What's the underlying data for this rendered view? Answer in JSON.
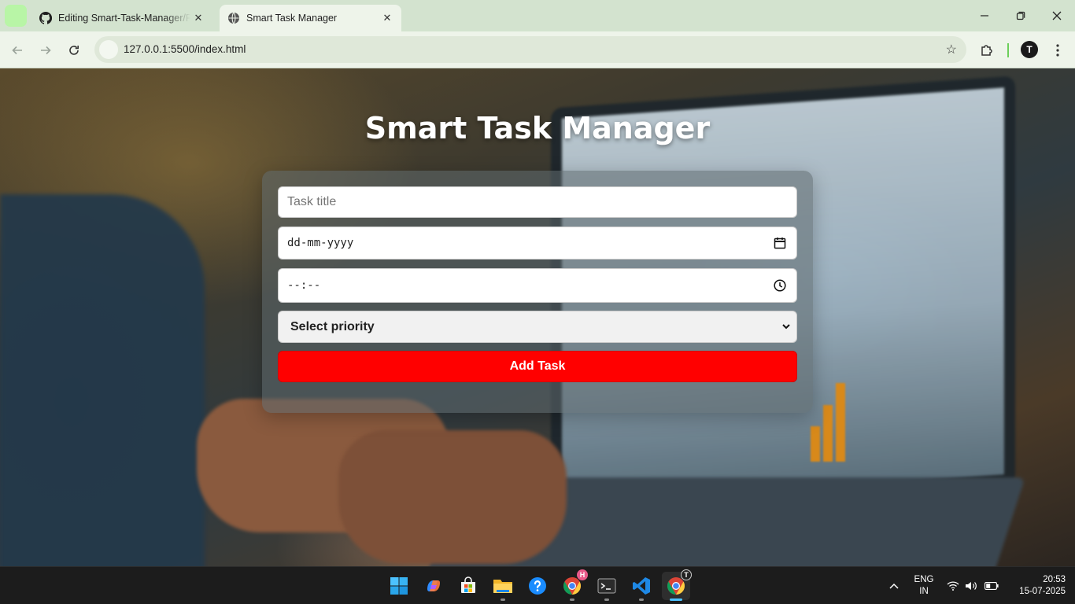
{
  "browser": {
    "tabs": [
      {
        "title": "Editing Smart-Task-Manager/README.md",
        "icon": "github-icon",
        "active": false
      },
      {
        "title": "Smart Task Manager",
        "icon": "globe-icon",
        "active": true
      }
    ],
    "url": "127.0.0.1:5500/index.html",
    "profile_initial": "T"
  },
  "page": {
    "title": "Smart Task Manager",
    "form": {
      "task_title_placeholder": "Task title",
      "date_placeholder": "dd-mm-yyyy",
      "time_placeholder": "--:--",
      "priority_label": "Select priority",
      "add_button": "Add Task"
    }
  },
  "taskbar": {
    "apps": [
      "start",
      "copilot",
      "store",
      "file-explorer",
      "get-help",
      "chrome-profile-h",
      "terminal",
      "vscode",
      "chrome-profile-t"
    ],
    "chrome_badge": "H",
    "lang_line1": "ENG",
    "lang_line2": "IN",
    "time": "20:53",
    "date": "15-07-2025"
  },
  "colors": {
    "accent_button": "#ff0000",
    "tab_strip": "#d3e3cf",
    "toolbar": "#eef4ea",
    "taskbar": "#1c1c1c"
  }
}
